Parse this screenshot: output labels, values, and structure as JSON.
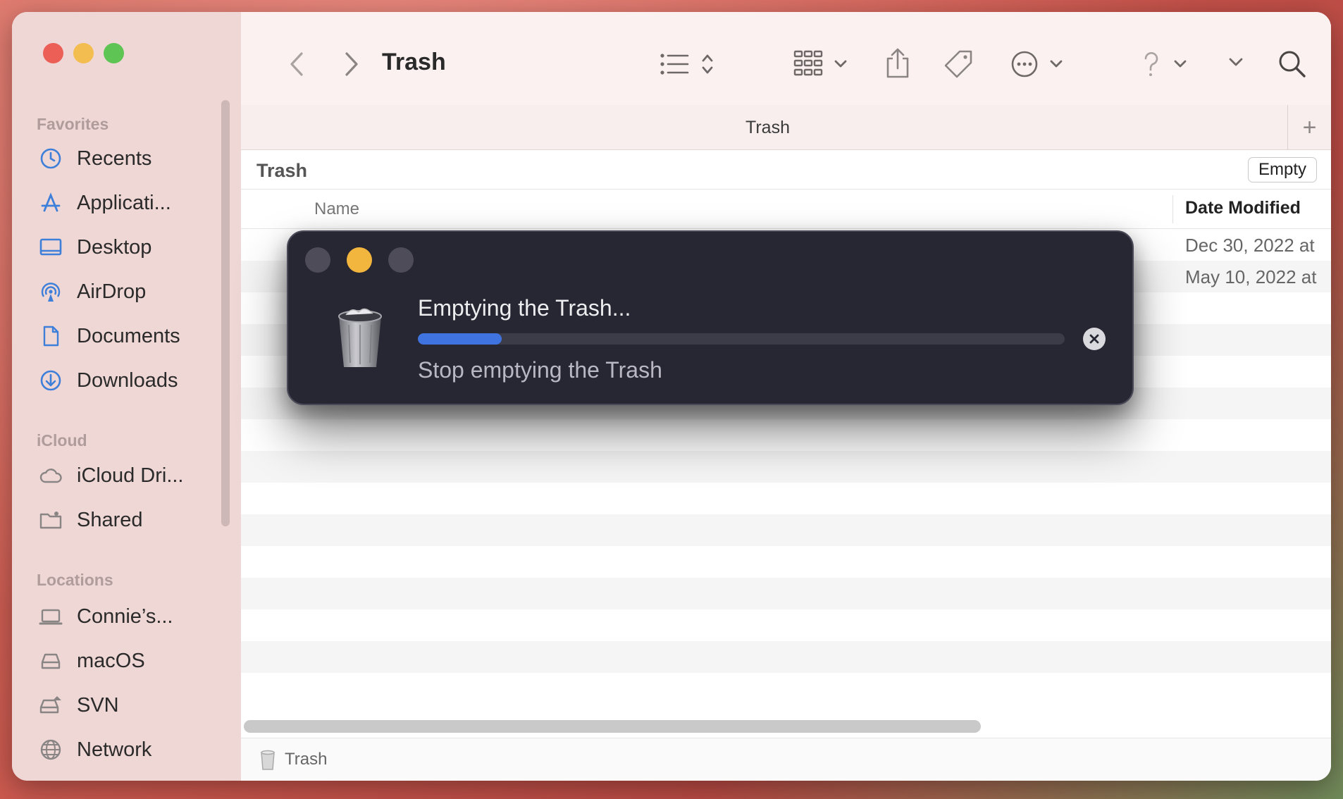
{
  "window": {
    "title": "Trash",
    "tab_title": "Trash",
    "path_title": "Trash",
    "status_label": "Trash"
  },
  "toolbar": {
    "back_icon": "chevron-left-icon",
    "forward_icon": "chevron-right-icon",
    "view_icon": "list-view-icon",
    "group_icon": "grid-group-icon",
    "share_icon": "share-icon",
    "tag_icon": "tag-icon",
    "more_icon": "ellipsis-circle-icon",
    "help_icon": "question-icon",
    "search_icon": "search-icon"
  },
  "sidebar": {
    "sections": [
      {
        "title": "Favorites",
        "items": [
          {
            "label": "Recents",
            "icon": "clock-icon"
          },
          {
            "label": "Applicati...",
            "icon": "applications-icon"
          },
          {
            "label": "Desktop",
            "icon": "desktop-icon"
          },
          {
            "label": "AirDrop",
            "icon": "airdrop-icon"
          },
          {
            "label": "Documents",
            "icon": "document-icon"
          },
          {
            "label": "Downloads",
            "icon": "download-icon"
          }
        ]
      },
      {
        "title": "iCloud",
        "items": [
          {
            "label": "iCloud Dri...",
            "icon": "cloud-icon"
          },
          {
            "label": "Shared",
            "icon": "shared-folder-icon"
          }
        ]
      },
      {
        "title": "Locations",
        "items": [
          {
            "label": "Connie’s...",
            "icon": "laptop-icon"
          },
          {
            "label": "macOS",
            "icon": "disk-icon"
          },
          {
            "label": "SVN",
            "icon": "eject-disk-icon"
          },
          {
            "label": "Network",
            "icon": "globe-icon"
          }
        ]
      }
    ]
  },
  "list": {
    "empty_button": "Empty",
    "columns": {
      "name": "Name",
      "date_modified": "Date Modified"
    },
    "rows": [
      {
        "date": "Dec 30, 2022 at"
      },
      {
        "date": "May 10, 2022 at"
      }
    ]
  },
  "dialog": {
    "title": "Emptying the Trash...",
    "stop_label": "Stop emptying the Trash",
    "progress_fraction": 0.13,
    "progress_color": "#3f74e0",
    "cancel_icon": "close-circle-icon"
  }
}
